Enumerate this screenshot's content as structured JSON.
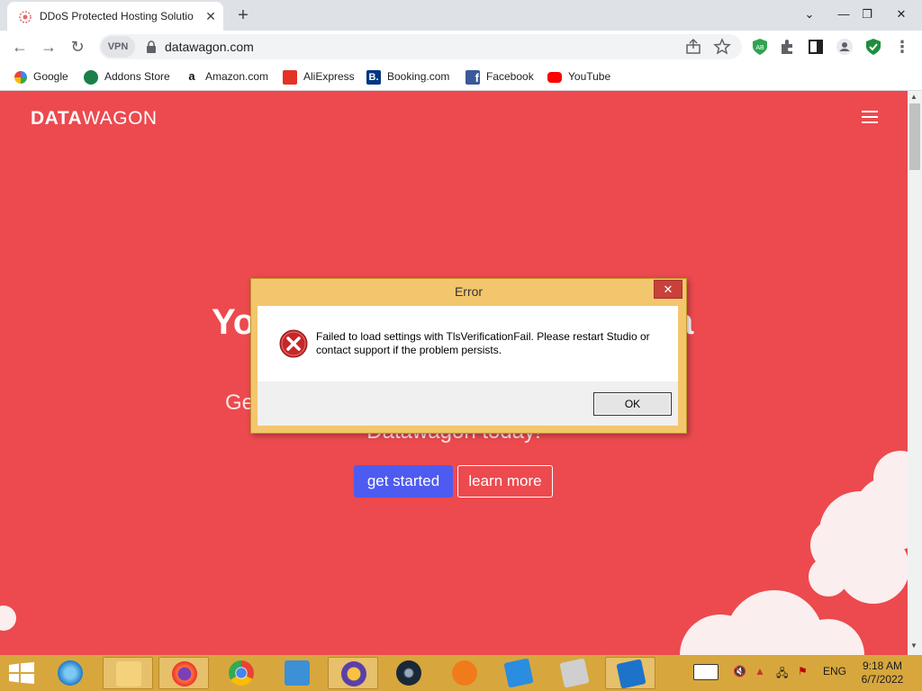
{
  "browser": {
    "tab_title": "DDoS Protected Hosting Solutio",
    "url": "datawagon.com",
    "vpn_label": "VPN",
    "bookmarks": [
      "Google",
      "Addons Store",
      "Amazon.com",
      "AliExpress",
      "Booking.com",
      "Facebook",
      "YouTube"
    ]
  },
  "page": {
    "brand_bold": "DATA",
    "brand_light": "WAGON",
    "hero_title_left": "Yo",
    "hero_title_right": "a",
    "hero_sub_left": "Ge",
    "hero_sub_bottom": "Datawagon today!",
    "get_started": "get started",
    "learn_more": "learn more"
  },
  "dialog": {
    "title": "Error",
    "close": "✕",
    "message": "Failed to load settings with TlsVerificationFail. Please restart Studio or contact support if the problem persists.",
    "ok": "OK"
  },
  "taskbar": {
    "lang": "ENG",
    "time": "9:18 AM",
    "date": "6/7/2022"
  },
  "colors": {
    "page_bg": "#ec4a4e",
    "primary_button": "#4d5bf0",
    "taskbar": "#d7a73d",
    "dialog_frame": "#f3c66d"
  }
}
